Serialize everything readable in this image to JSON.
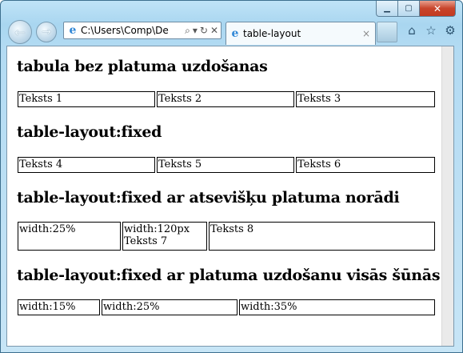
{
  "browser": {
    "address": "C:\\Users\\Comp\\De",
    "tab_title": "table-layout",
    "tab_close_glyph": "×",
    "address_close_glyph": "✕",
    "icons": [
      "ie-icon",
      "search-icon",
      "refresh-icon",
      "home-icon",
      "star-icon",
      "gear-icon"
    ]
  },
  "page": {
    "sections": [
      {
        "heading": "tabula bez platuma uzdošanas",
        "cells": [
          "Teksts 1",
          "Teksts 2",
          "Teksts 3"
        ]
      },
      {
        "heading": "table-layout:fixed",
        "cells": [
          "Teksts 4",
          "Teksts 5",
          "Teksts 6"
        ]
      },
      {
        "heading": "table-layout:fixed ar atsevišķu platuma norādi",
        "cells": [
          "width:25%",
          "width:120px\nTeksts 7",
          "Teksts 8"
        ]
      },
      {
        "heading": "table-layout:fixed ar platuma uzdošanu visās šūnās",
        "cells": [
          "width:15%",
          "width:25%",
          "width:35%"
        ]
      }
    ]
  }
}
